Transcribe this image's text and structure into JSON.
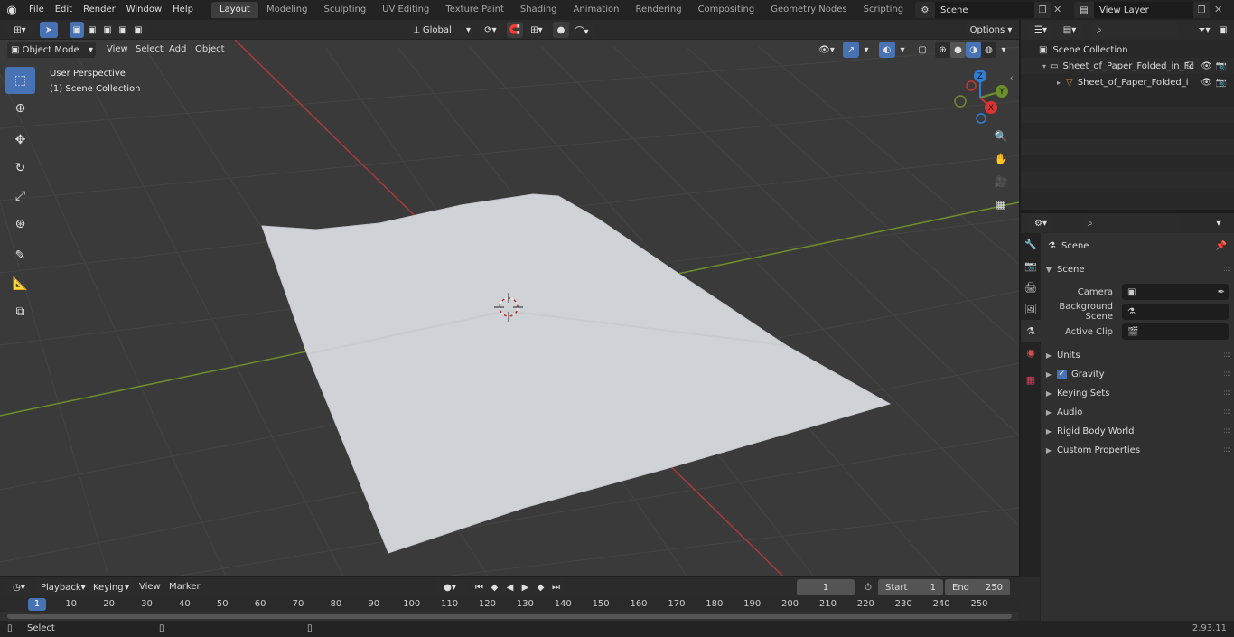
{
  "menu": [
    "File",
    "Edit",
    "Render",
    "Window",
    "Help"
  ],
  "workspaces": [
    "Layout",
    "Modeling",
    "Sculpting",
    "UV Editing",
    "Texture Paint",
    "Shading",
    "Animation",
    "Rendering",
    "Compositing",
    "Geometry Nodes",
    "Scripting"
  ],
  "active_workspace": "Layout",
  "scene_name": "Scene",
  "view_layer": "View Layer",
  "viewport": {
    "mode": "Object Mode",
    "menus": [
      "View",
      "Select",
      "Add",
      "Object"
    ],
    "transform_orientation": "Global",
    "options_label": "Options",
    "perspective_label": "User Perspective",
    "collection_label": "(1) Scene Collection",
    "gizmo_axes": [
      "X",
      "Y",
      "Z"
    ]
  },
  "outliner": {
    "root": "Scene Collection",
    "items": [
      {
        "label": "Sheet_of_Paper_Folded_in_Fc"
      },
      {
        "label": "Sheet_of_Paper_Folded_i"
      }
    ]
  },
  "properties": {
    "title": "Scene",
    "section": "Scene",
    "fields": [
      {
        "label": "Camera"
      },
      {
        "label": "Background Scene"
      },
      {
        "label": "Active Clip"
      }
    ],
    "panels": [
      "Units",
      "Gravity",
      "Keying Sets",
      "Audio",
      "Rigid Body World",
      "Custom Properties"
    ]
  },
  "timeline": {
    "menus": [
      "Playback",
      "Keying",
      "View",
      "Marker"
    ],
    "current_frame": "1",
    "start_label": "Start",
    "start": "1",
    "end_label": "End",
    "end": "250",
    "ticks": [
      "1",
      "10",
      "20",
      "30",
      "40",
      "50",
      "60",
      "70",
      "80",
      "90",
      "100",
      "110",
      "120",
      "130",
      "140",
      "150",
      "160",
      "170",
      "180",
      "190",
      "200",
      "210",
      "220",
      "230",
      "240",
      "250"
    ]
  },
  "status": {
    "select_label": "Select",
    "version": "2.93.11"
  },
  "colors": {
    "accent": "#4772b3",
    "x_axis": "#a83a3a",
    "y_axis": "#6c8f2a",
    "z_axis": "#2f7fd8"
  }
}
